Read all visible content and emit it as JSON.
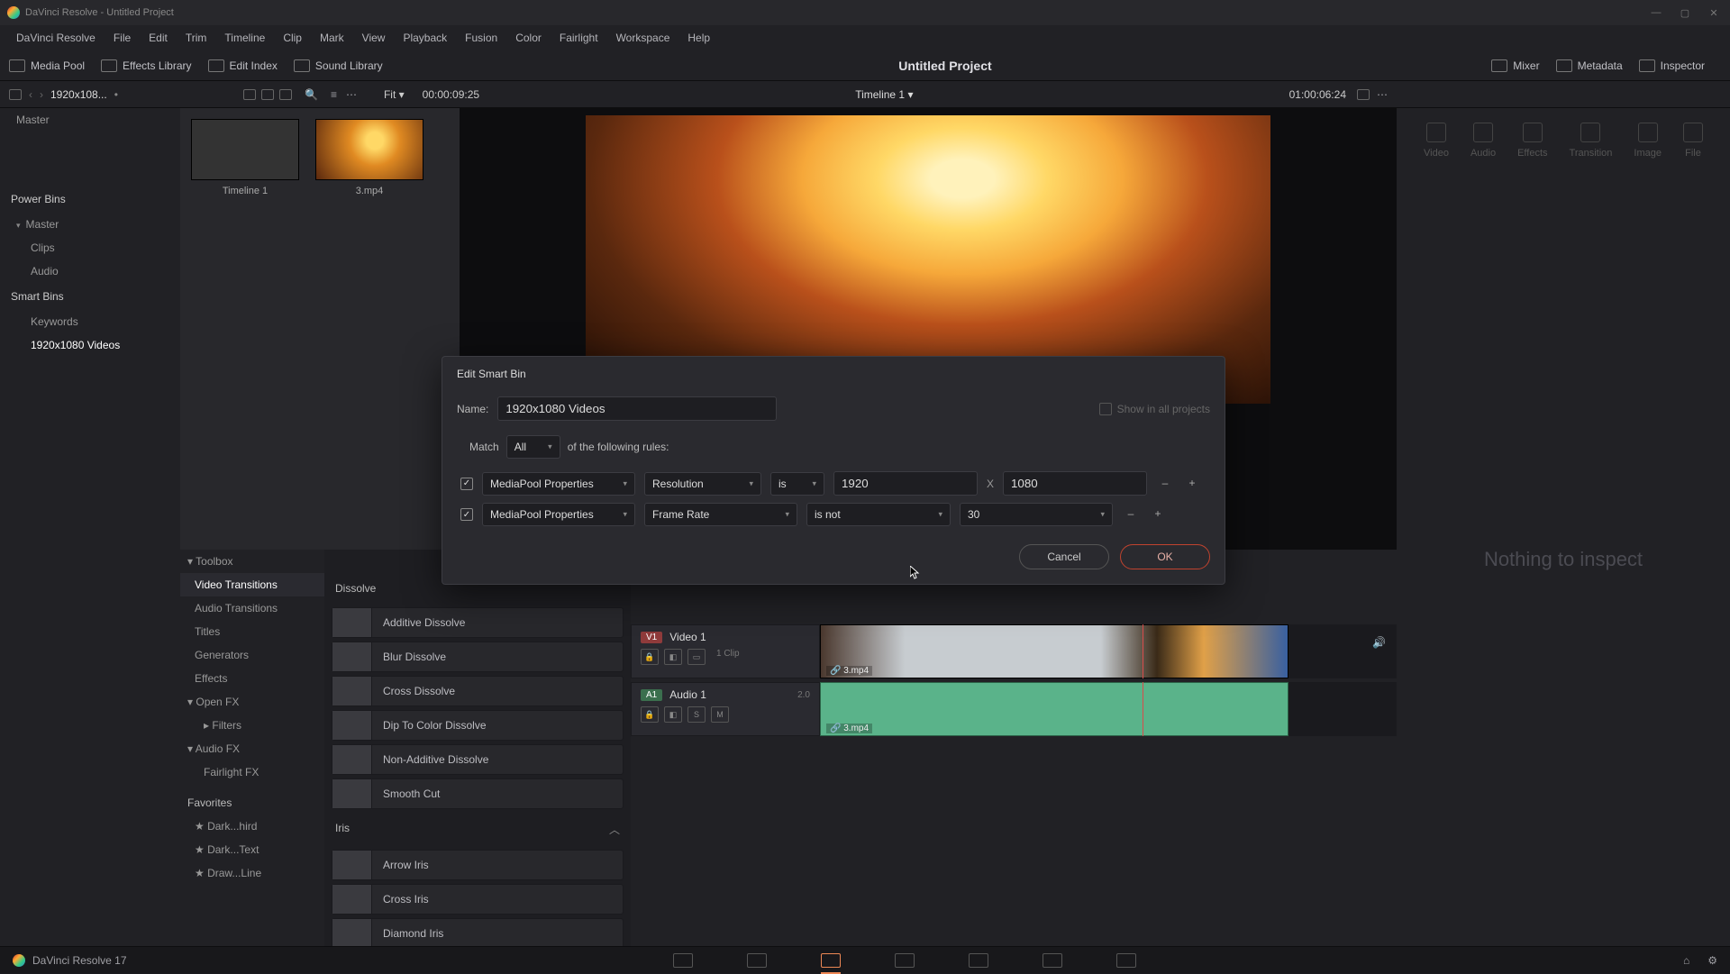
{
  "titlebar": {
    "text": "DaVinci Resolve - Untitled Project"
  },
  "menubar": [
    "DaVinci Resolve",
    "File",
    "Edit",
    "Trim",
    "Timeline",
    "Clip",
    "Mark",
    "View",
    "Playback",
    "Fusion",
    "Color",
    "Fairlight",
    "Workspace",
    "Help"
  ],
  "toolsbar": {
    "left": [
      {
        "name": "media-pool-toggle",
        "label": "Media Pool"
      },
      {
        "name": "effects-library-toggle",
        "label": "Effects Library"
      },
      {
        "name": "edit-index-toggle",
        "label": "Edit Index"
      },
      {
        "name": "sound-library-toggle",
        "label": "Sound Library"
      }
    ],
    "project_title": "Untitled Project",
    "right": [
      {
        "name": "mixer-toggle",
        "label": "Mixer"
      },
      {
        "name": "metadata-toggle",
        "label": "Metadata"
      },
      {
        "name": "inspector-toggle",
        "label": "Inspector"
      }
    ]
  },
  "subhead": {
    "bin_label": "1920x108...",
    "fit_label": "Fit",
    "timecode_left": "00:00:09:25",
    "timeline_name": "Timeline 1",
    "timecode_right": "01:00:06:24"
  },
  "bins": {
    "master": "Master",
    "power_head": "Power Bins",
    "power": [
      "Master",
      "Clips",
      "Audio"
    ],
    "smart_head": "Smart Bins",
    "smart": [
      "Keywords",
      "1920x1080 Videos"
    ]
  },
  "pool": [
    {
      "name": "timeline-thumb",
      "caption": "Timeline 1"
    },
    {
      "name": "clip-thumb",
      "caption": "3.mp4"
    }
  ],
  "inspector_tabs": [
    "Video",
    "Audio",
    "Effects",
    "Transition",
    "Image",
    "File"
  ],
  "inspector_empty": "Nothing to inspect",
  "toolbox": {
    "title": "Toolbox",
    "items": [
      "Video Transitions",
      "Audio Transitions",
      "Titles",
      "Generators",
      "Effects"
    ],
    "openfx": "Open FX",
    "filters": "Filters",
    "audiofx": "Audio FX",
    "fairlight": "Fairlight FX",
    "fav_head": "Favorites",
    "favorites": [
      "Dark...hird",
      "Dark...Text",
      "Draw...Line"
    ]
  },
  "fx": {
    "cat1": "Dissolve",
    "list1": [
      "Additive Dissolve",
      "Blur Dissolve",
      "Cross Dissolve",
      "Dip To Color Dissolve",
      "Non-Additive Dissolve",
      "Smooth Cut"
    ],
    "cat2": "Iris",
    "list2": [
      "Arrow Iris",
      "Cross Iris",
      "Diamond Iris"
    ]
  },
  "timeline": {
    "tc": "01:00:06:24",
    "video": {
      "badge": "V1",
      "name": "Video 1",
      "clip_count": "1 Clip",
      "clip": "3.mp4"
    },
    "audio": {
      "badge": "A1",
      "name": "Audio 1",
      "channels": "2.0",
      "clip": "3.mp4",
      "btn_s": "S",
      "btn_m": "M"
    }
  },
  "bottombar": {
    "app": "DaVinci Resolve 17"
  },
  "dialog": {
    "title": "Edit Smart Bin",
    "name_label": "Name:",
    "name_value": "1920x1080 Videos",
    "show_all": "Show in all projects",
    "match_pre": "Match",
    "match_mode": "All",
    "match_post": "of the following rules:",
    "rules": [
      {
        "group": "MediaPool Properties",
        "field": "Resolution",
        "op": "is",
        "val1": "1920",
        "x": "X",
        "val2": "1080"
      },
      {
        "group": "MediaPool Properties",
        "field": "Frame Rate",
        "op": "is not",
        "val": "30"
      }
    ],
    "cancel": "Cancel",
    "ok": "OK"
  }
}
